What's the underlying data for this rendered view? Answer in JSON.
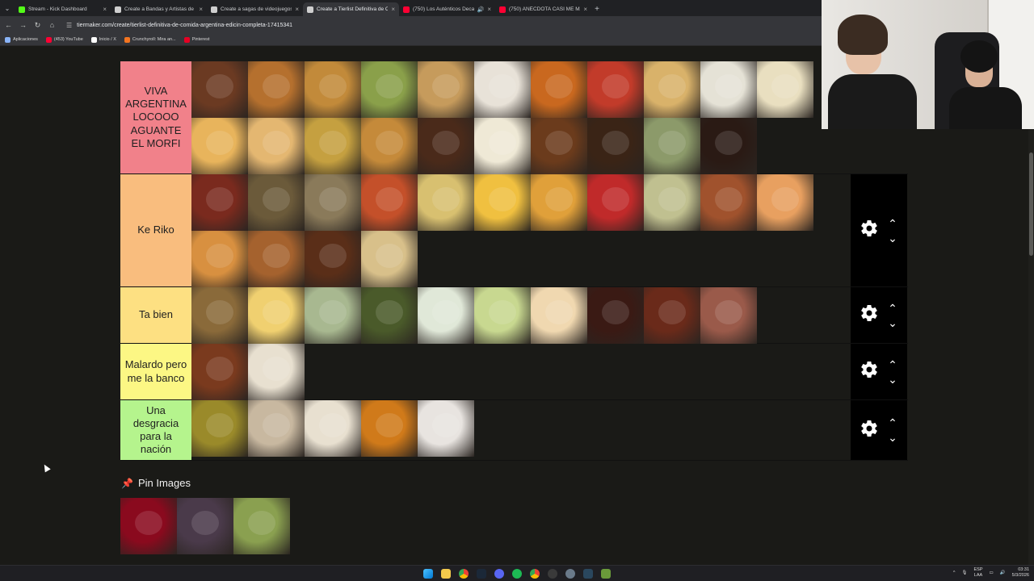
{
  "browser": {
    "tabs": [
      {
        "title": "Stream - Kick Dashboard",
        "favicon_color": "#53fc18",
        "active": false
      },
      {
        "title": "Create a Bandas y Artistas de F",
        "favicon_color": "#cfcfcf",
        "active": false
      },
      {
        "title": "Create a sagas de videojuegos",
        "favicon_color": "#cfcfcf",
        "active": false
      },
      {
        "title": "Create a Tierlist Definitiva de C",
        "favicon_color": "#cfcfcf",
        "active": true
      },
      {
        "title": "(750) Los Auténticos Decad",
        "favicon_color": "#ff0033",
        "active": false,
        "sound": true
      },
      {
        "title": "(750) ANÉCDOTA CASI ME MA",
        "favicon_color": "#ff0033",
        "active": false
      }
    ],
    "url": "tiermaker.com/create/tierlist-definitiva-de-comida-argentina-edicin-completa-17415341",
    "bookmarks": [
      {
        "label": "Aplicaciones",
        "color": "#8ab4f8"
      },
      {
        "label": "(453) YouTube",
        "color": "#ff0033"
      },
      {
        "label": "Inicio / X",
        "color": "#ffffff"
      },
      {
        "label": "Crunchyroll: Mira an...",
        "color": "#f47521"
      },
      {
        "label": "Pinterest",
        "color": "#e60023"
      }
    ]
  },
  "tiers": [
    {
      "label": "VIVA ARGENTINA LOCOOO AGUANTE EL MORFI",
      "color": "#f1818a",
      "height": 140,
      "items": [
        "#6b3a22",
        "#b5702e",
        "#c28a3a",
        "#8aa04a",
        "#c69b5c",
        "#e8e2d8",
        "#c9681f",
        "#c23b2a",
        "#d9b26a",
        "#e5e2d6",
        "#e9dfc0",
        "#e8b45c",
        "#e4b771",
        "#c5a040",
        "#c58a3a",
        "#4a2a1a",
        "#efe9d6",
        "#6b3b1c",
        "#3a2416",
        "#8c9a6a",
        "#2a1a14"
      ]
    },
    {
      "label": "Ke Riko",
      "color": "#f9bd7e",
      "height": 140,
      "items": [
        "#7a2a1e",
        "#6b5a3a",
        "#8a7a5a",
        "#c4502a",
        "#d8c070",
        "#f0c040",
        "#e0a03a",
        "#c02a2a",
        "#c0c090",
        "#a0522d",
        "#e8a060",
        "#d89040",
        "#a5622e",
        "#5a2e18",
        "#d8c08a"
      ]
    },
    {
      "label": "Ta bien",
      "color": "#fde082",
      "height": 70,
      "items": [
        "#8a6a3a",
        "#f0d070",
        "#a8b890",
        "#4a5a2a",
        "#e0e8d8",
        "#c8d890",
        "#f0d8b0",
        "#3a1a14",
        "#6a2a1a",
        "#9a5a4a"
      ]
    },
    {
      "label": "Malardo pero me la banco",
      "color": "#fcf784",
      "height": 70,
      "items": [
        "#7a3a1e",
        "#e8e0d0"
      ]
    },
    {
      "label": "Una desgracia para la nación",
      "color": "#b5f48d",
      "height": 75,
      "items": [
        "#9a8a2a",
        "#c8b8a0",
        "#e8e0d0",
        "#d07a1a",
        "#e8e4e0"
      ]
    }
  ],
  "pin_section": {
    "title": "Pin Images",
    "items": [
      "#8a0a1e",
      "#4a3a4a",
      "#8aa050"
    ]
  },
  "taskbar": {
    "lang_top": "ESP",
    "lang_bottom": "LAA",
    "time": "03:31",
    "date": "5/3/2026"
  }
}
